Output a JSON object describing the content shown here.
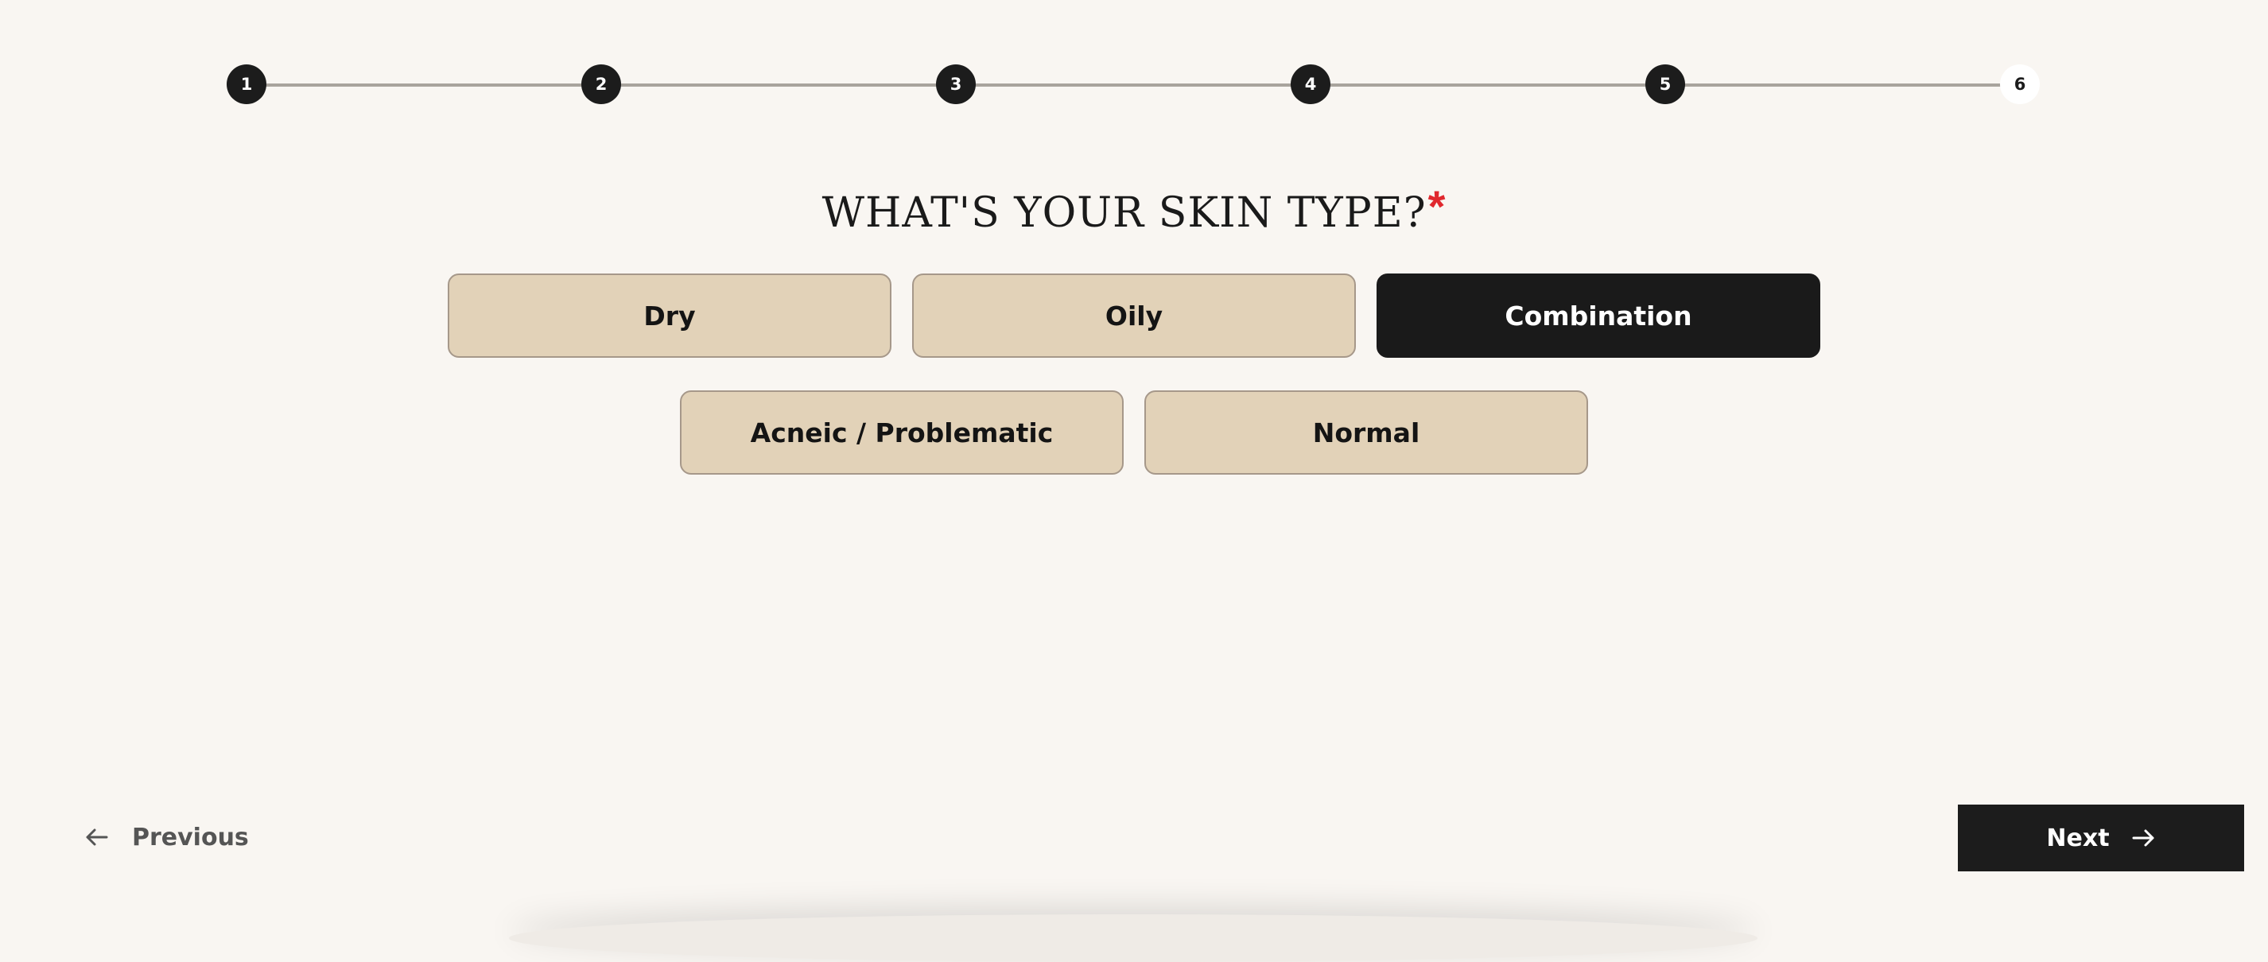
{
  "stepper": {
    "steps": [
      "1",
      "2",
      "3",
      "4",
      "5",
      "6"
    ],
    "current_step": 6
  },
  "question": {
    "title": "WHAT'S YOUR SKIN TYPE?",
    "required_mark": "*"
  },
  "options": {
    "dry": "Dry",
    "oily": "Oily",
    "combination": "Combination",
    "acneic": "Acneic / Problematic",
    "normal": "Normal",
    "selected": "Combination"
  },
  "nav": {
    "previous_label": "Previous",
    "next_label": "Next"
  },
  "colors": {
    "background": "#f9f6f2",
    "option_bg": "#e2d2b8",
    "selected_bg": "#1a1a1a",
    "required_mark": "#e0282e"
  },
  "icons": {
    "previous": "arrow-left-icon",
    "next": "arrow-right-icon"
  }
}
